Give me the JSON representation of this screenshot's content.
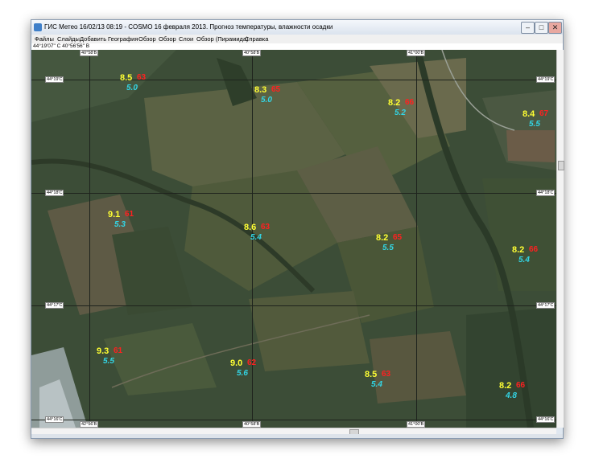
{
  "window": {
    "title": "ГИС Метео 16/02/13 08:19 - COSMO 16 февраля 2013. Прогноз температуры, влажности осадки",
    "buttons": {
      "minimize": "–",
      "maximize": "□",
      "close": "✕"
    }
  },
  "menu": [
    "Файлы",
    "Слайды",
    "Добавить",
    "География",
    "Обзор",
    "Обзор",
    "Слои",
    "Обзор (Пирамида)",
    "Справка"
  ],
  "coords": "44°19'07\" С 40°56'56\" В",
  "grid": {
    "lat_labels": [
      "44°19'С",
      "44°18'С",
      "44°17'С",
      "44°16'С"
    ],
    "lon_labels": [
      "40°58'В",
      "40°58'В",
      "41°00'В"
    ],
    "bottom_lon_labels": [
      "42°56'В",
      "40°58'В",
      "41°00'В"
    ]
  },
  "stations": [
    {
      "temp": "8.5",
      "hum": "63",
      "prec": "5.0"
    },
    {
      "temp": "8.3",
      "hum": "65",
      "prec": "5.0"
    },
    {
      "temp": "8.2",
      "hum": "66",
      "prec": "5.2"
    },
    {
      "temp": "8.4",
      "hum": "67",
      "prec": "5.5"
    },
    {
      "temp": "9.1",
      "hum": "61",
      "prec": "5.3"
    },
    {
      "temp": "8.6",
      "hum": "63",
      "prec": "5.4"
    },
    {
      "temp": "8.2",
      "hum": "65",
      "prec": "5.5"
    },
    {
      "temp": "8.2",
      "hum": "66",
      "prec": "5.4"
    },
    {
      "temp": "9.3",
      "hum": "61",
      "prec": "5.5"
    },
    {
      "temp": "9.0",
      "hum": "62",
      "prec": "5.6"
    },
    {
      "temp": "8.5",
      "hum": "63",
      "prec": "5.4"
    },
    {
      "temp": "8.2",
      "hum": "66",
      "prec": "4.8"
    }
  ]
}
